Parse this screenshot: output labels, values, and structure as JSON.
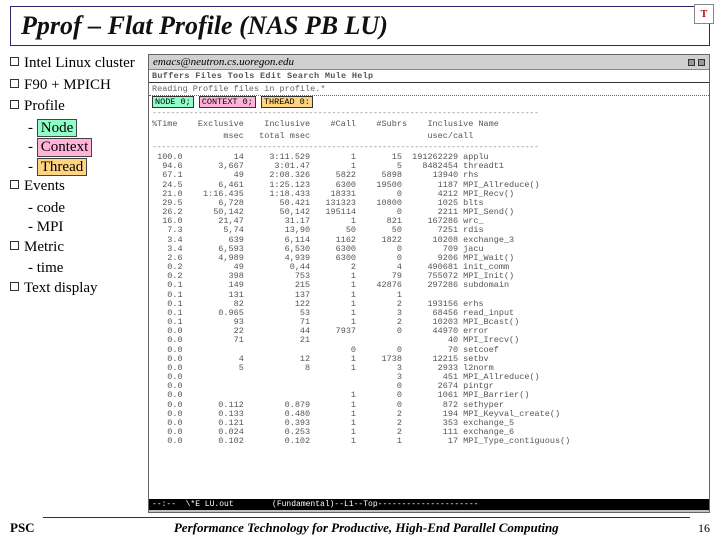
{
  "title": "Pprof – Flat Profile (NAS PB LU)",
  "corner_icon_label": "T",
  "left": {
    "b1": "Intel Linux cluster",
    "b2": "F90 + MPICH",
    "b3": "Profile",
    "b3a": "Node",
    "b3b": "Context",
    "b3c": "Thread",
    "b4": "Events",
    "b4a": "- code",
    "b4b": "- MPI",
    "b5": "Metric",
    "b5a": "- time",
    "b6": "Text display"
  },
  "emacs": {
    "title": "emacs@neutron.cs.uoregon.edu",
    "menu": "Buffers Files Tools Edit Search Mule Help",
    "status": "Reading Profile files in profile.*",
    "node": "NODE 0;",
    "context": "CONTEXT 0;",
    "thread": "THREAD 0:",
    "header1": "%Time    Exclusive    Inclusive    #Call    #Subrs    Inclusive Name",
    "header2": "              msec   total msec                       usec/call",
    "modeline": "--:--  \\*E LU.out        (Fundamental)--L1--Top---------------------",
    "bottom": ""
  },
  "rows": [
    {
      "t": "100.0",
      "ex": "14",
      "in": "3:11.529",
      "c": "1",
      "s": "15",
      "uc": "191262229",
      "nm": "applu"
    },
    {
      "t": "94.6",
      "ex": "3,667",
      "in": "3:01.47",
      "c": "1",
      "s": "5",
      "uc": "8482454",
      "nm": "threadt1"
    },
    {
      "t": "67.1",
      "ex": "49",
      "in": "2:08.326",
      "c": "5822",
      "s": "5898",
      "uc": "13940",
      "nm": "rhs"
    },
    {
      "t": "24.5",
      "ex": "6,461",
      "in": "1:25.123",
      "c": "6300",
      "s": "19500",
      "uc": "1187",
      "nm": "MPI_Allreduce()"
    },
    {
      "t": "21.0",
      "ex": "1:16.435",
      "in": "1:18.433",
      "c": "18331",
      "s": "0",
      "uc": "4212",
      "nm": "MPI_Recv()"
    },
    {
      "t": "29.5",
      "ex": "6,728",
      "in": "50.421",
      "c": "131323",
      "s": "10800",
      "uc": "1025",
      "nm": "blts"
    },
    {
      "t": "26.2",
      "ex": "50,142",
      "in": "50,142",
      "c": "195114",
      "s": "0",
      "uc": "2211",
      "nm": "MPI_Send()"
    },
    {
      "t": "16.0",
      "ex": "21,47",
      "in": "31.17",
      "c": "1",
      "s": "821",
      "uc": "167286",
      "nm": "wrc_"
    },
    {
      "t": "7.3",
      "ex": "5,74",
      "in": "13,90",
      "c": "50",
      "s": "50",
      "uc": "7251",
      "nm": "rdis"
    },
    {
      "t": "3.4",
      "ex": "639",
      "in": "6,114",
      "c": "1162",
      "s": "1822",
      "uc": "10208",
      "nm": "exchange_3"
    },
    {
      "t": "3.4",
      "ex": "6,593",
      "in": "6,530",
      "c": "6300",
      "s": "0",
      "uc": "709",
      "nm": "jacu"
    },
    {
      "t": "2.6",
      "ex": "4,989",
      "in": "4,939",
      "c": "6300",
      "s": "0",
      "uc": "9206",
      "nm": "MPI_Wait()"
    },
    {
      "t": "0.2",
      "ex": "49",
      "in": "0,44",
      "c": "2",
      "s": "4",
      "uc": "490681",
      "nm": "init_comm"
    },
    {
      "t": "0.2",
      "ex": "398",
      "in": "753",
      "c": "1",
      "s": "79",
      "uc": "755072",
      "nm": "MPI_Init()"
    },
    {
      "t": "0.1",
      "ex": "149",
      "in": "215",
      "c": "1",
      "s": "42876",
      "uc": "297286",
      "nm": "subdomain"
    },
    {
      "t": "0.1",
      "ex": "131",
      "in": "137",
      "c": "1",
      "s": "1",
      "uc": "",
      "nm": ""
    },
    {
      "t": "0.1",
      "ex": "82",
      "in": "122",
      "c": "1",
      "s": "2",
      "uc": "193156",
      "nm": "erhs"
    },
    {
      "t": "0.1",
      "ex": "0.965",
      "in": "53",
      "c": "1",
      "s": "3",
      "uc": "68456",
      "nm": "read_input"
    },
    {
      "t": "0.1",
      "ex": "93",
      "in": "71",
      "c": "1",
      "s": "2",
      "uc": "10203",
      "nm": "MPI_Bcast()"
    },
    {
      "t": "0.0",
      "ex": "22",
      "in": "44",
      "c": "7937",
      "s": "0",
      "uc": "44970",
      "nm": "error"
    },
    {
      "t": "0.0",
      "ex": "71",
      "in": "21",
      "c": "",
      "s": "",
      "uc": "40",
      "nm": "MPI_Irecv()"
    },
    {
      "t": "0.0",
      "ex": "",
      "in": "",
      "c": "0",
      "s": "0",
      "uc": "70",
      "nm": "setcoef"
    },
    {
      "t": "0.0",
      "ex": "4",
      "in": "12",
      "c": "1",
      "s": "1738",
      "uc": "12215",
      "nm": "setbv"
    },
    {
      "t": "0.0",
      "ex": "5",
      "in": "8",
      "c": "1",
      "s": "3",
      "uc": "2933",
      "nm": "l2norm"
    },
    {
      "t": "0.0",
      "ex": "",
      "in": "",
      "c": "",
      "s": "3",
      "uc": "451",
      "nm": "MPI_Allreduce()"
    },
    {
      "t": "0.0",
      "ex": "",
      "in": "",
      "c": "",
      "s": "0",
      "uc": "2674",
      "nm": "pintgr"
    },
    {
      "t": "0.0",
      "ex": "",
      "in": "",
      "c": "1",
      "s": "0",
      "uc": "1061",
      "nm": "MPI_Barrier()"
    },
    {
      "t": "0.0",
      "ex": "0.112",
      "in": "0.879",
      "c": "1",
      "s": "0",
      "uc": "872",
      "nm": "sethyper"
    },
    {
      "t": "0.0",
      "ex": "0.133",
      "in": "0.480",
      "c": "1",
      "s": "2",
      "uc": "194",
      "nm": "MPI_Keyval_create()"
    },
    {
      "t": "0.0",
      "ex": "0.121",
      "in": "0.393",
      "c": "1",
      "s": "2",
      "uc": "353",
      "nm": "exchange_5"
    },
    {
      "t": "0.0",
      "ex": "0.024",
      "in": "0.253",
      "c": "1",
      "s": "2",
      "uc": "111",
      "nm": "exchange_6"
    },
    {
      "t": "0.0",
      "ex": "0.102",
      "in": "0.102",
      "c": "1",
      "s": "1",
      "uc": "17",
      "nm": "MPI_Type_contiguous()"
    }
  ],
  "footer": {
    "left": "PSC",
    "center": "Performance Technology for Productive, High-End Parallel Computing",
    "right": "16"
  }
}
